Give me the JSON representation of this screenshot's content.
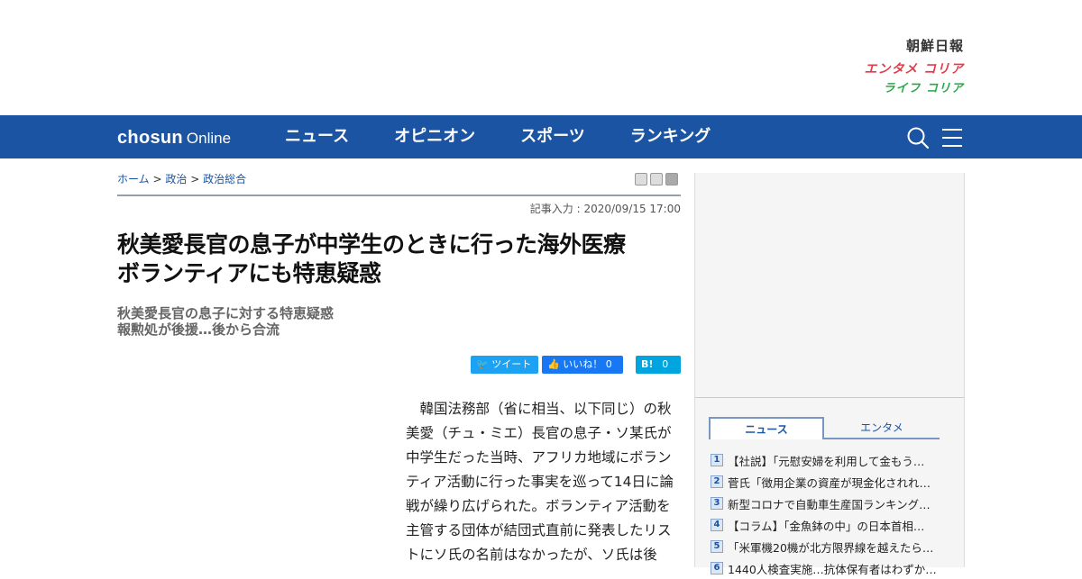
{
  "brands": {
    "chosun": "朝鮮日報",
    "entame": "エンタメ コリア",
    "life": "ライフ コリア"
  },
  "nav": {
    "logo_main": "chosun",
    "logo_sub": "Online",
    "items": [
      "ニュース",
      "オピニオン",
      "スポーツ",
      "ランキング"
    ]
  },
  "breadcrumb": {
    "home": "ホーム",
    "sep": ">",
    "politics": "政治",
    "general": "政治総合"
  },
  "article": {
    "dateline": "記事入力 : 2020/09/15 17:00",
    "headline_1": "秋美愛長官の息子が中学生のときに行った海外医療",
    "headline_2": "ボランティアにも特恵疑惑",
    "subhead_1": "秋美愛長官の息子に対する特恵疑惑",
    "subhead_2": "報勲処が後援…後から合流",
    "body": "　韓国法務部（省に相当、以下同じ）の秋美愛（チュ・ミエ）長官の息子・ソ某氏が中学生だった当時、アフリカ地域にボランティア活動に行った事実を巡って14日に論戦が繰り広げられた。ボランティア活動を主管する団体が結団式直前に発表したリストにソ氏の名前はなかったが、ソ氏は後"
  },
  "social": {
    "tweet": "ツイート",
    "like": "いいね！",
    "like_count": "0",
    "hatena": "B!",
    "hatena_count": "0"
  },
  "sidebar": {
    "tabs": [
      "ニュース",
      "エンタメ"
    ],
    "ranking": [
      {
        "num": "1",
        "title": "【社説】「元慰安婦を利用して金もう…"
      },
      {
        "num": "2",
        "title": "菅氏「徴用企業の資産が現金化されれ…"
      },
      {
        "num": "3",
        "title": "新型コロナで自動車生産国ランキング…"
      },
      {
        "num": "4",
        "title": "【コラム】「金魚鉢の中」の日本首相…"
      },
      {
        "num": "5",
        "title": "「米軍機20機が北方限界線を越えたら…"
      },
      {
        "num": "6",
        "title": "1440人検査実施…抗体保有者はわずか…"
      }
    ]
  },
  "colors": {
    "nav_bg": "#1a54a3",
    "twitter": "#1da1f2",
    "facebook": "#1877f2",
    "hatena": "#00a4de"
  }
}
